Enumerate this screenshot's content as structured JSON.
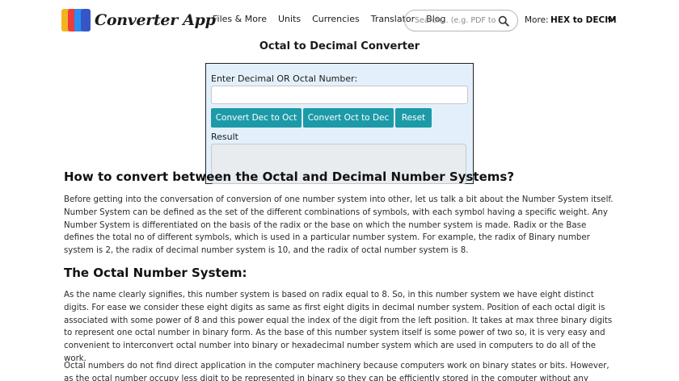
{
  "header": {
    "logo_text": "Converter App",
    "nav": [
      "Files & More",
      "Units",
      "Currencies",
      "Translator",
      "Blog"
    ],
    "search_placeholder": "Search... (e.g. PDF to JPG)",
    "more_label": "More:",
    "more_selected": "HEX to DECIMAL"
  },
  "page_title": "Octal to Decimal Converter",
  "converter": {
    "input_label": "Enter Decimal OR Octal Number:",
    "input_value": "",
    "buttons": [
      "Convert Dec to Oct",
      "Convert Oct to Dec",
      "Reset"
    ],
    "result_label": "Result",
    "result_value": ""
  },
  "article": {
    "heading1": "How to convert between the Octal and Decimal Number Systems?",
    "para1": "Before getting into the conversation of conversion of one number system into other, let us talk a bit about the Number System itself. Number System can be defined as the set of the different combinations of symbols, with each symbol having a specific weight. Any Number System is differentiated on the basis of the radix or the base on which the number system is made. Radix or the Base defines the total no of different symbols, which is used in a particular number system. For example, the radix of Binary number system is 2, the radix of decimal number system is 10, and the radix of octal number system is 8.",
    "heading2": "The Octal Number System:",
    "para2": "As the name clearly signifies, this number system is based on radix equal to 8. So, in this number system we have eight distinct digits. For ease we consider these eight digits as same as first eight digits in decimal number system. Position of each octal digit is associated with some power of 8 and this power equal the index of the digit from the left position. It takes at max three binary digits to represent one octal number in binary form. As the base of this number system itself is some power of two so, it is very easy and convenient to interconvert octal number into binary or hexadecimal number system which are used in computers to do all of the work.",
    "para3": "Octal numbers do not find direct application in the computer machinery because computers work on binary states or bits. However, as the octal number occupy less digit to be represented in binary so they can be efficiently stored in the computer without any wasted"
  },
  "colors": {
    "button": "#1d9aa8",
    "panel_bg": "#e3f0fc",
    "logo": [
      "#f5b21f",
      "#ee3b3b",
      "#2a8ff0",
      "#3656c8"
    ]
  },
  "icons": [
    "logo-mark-icon",
    "search-icon",
    "chevron-down-icon"
  ]
}
